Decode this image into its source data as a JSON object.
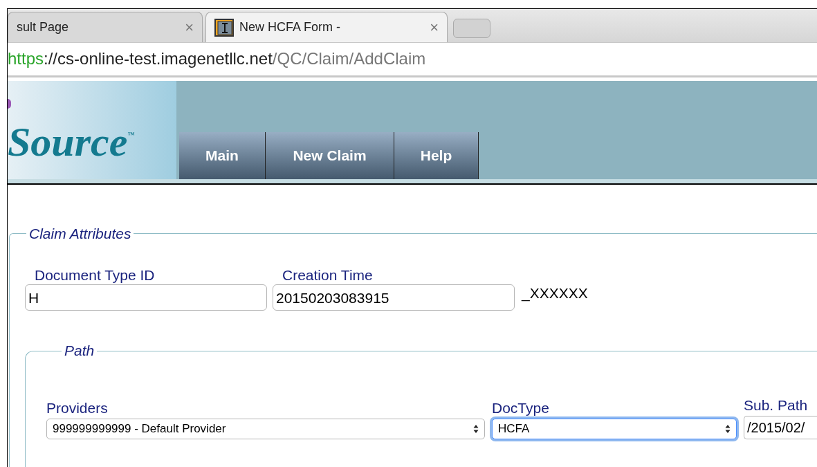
{
  "browser": {
    "tabs": [
      {
        "title": "sult Page",
        "close": "×",
        "selected": false
      },
      {
        "title": "New HCFA Form -",
        "close": "×",
        "selected": true
      }
    ],
    "url": {
      "scheme": "https",
      "host": "://cs-online-test.imagenetllc.net",
      "path": "/QC/Claim/AddClaim"
    }
  },
  "header": {
    "logo": "Source$^{™}$",
    "nav": [
      {
        "label": "Main"
      },
      {
        "label": "New Claim"
      },
      {
        "label": "Help"
      }
    ]
  },
  "claim_attributes": {
    "legend": "Claim Attributes",
    "fields": [
      {
        "label": "Document Type ID",
        "value": "H"
      },
      {
        "label": "Creation Time",
        "value": "20150203083915"
      }
    ],
    "suffix": "_XXXXXX"
  },
  "path": {
    "legend": "Path",
    "fields": [
      {
        "kind": "select",
        "label": "Providers",
        "value": "999999999999 - Default Provider",
        "focused": false
      },
      {
        "kind": "select",
        "label": "DocType",
        "value": "HCFA",
        "focused": true
      },
      {
        "kind": "text",
        "label": "Sub. Path",
        "value": "/2015/02/",
        "focused": false
      }
    ]
  }
}
